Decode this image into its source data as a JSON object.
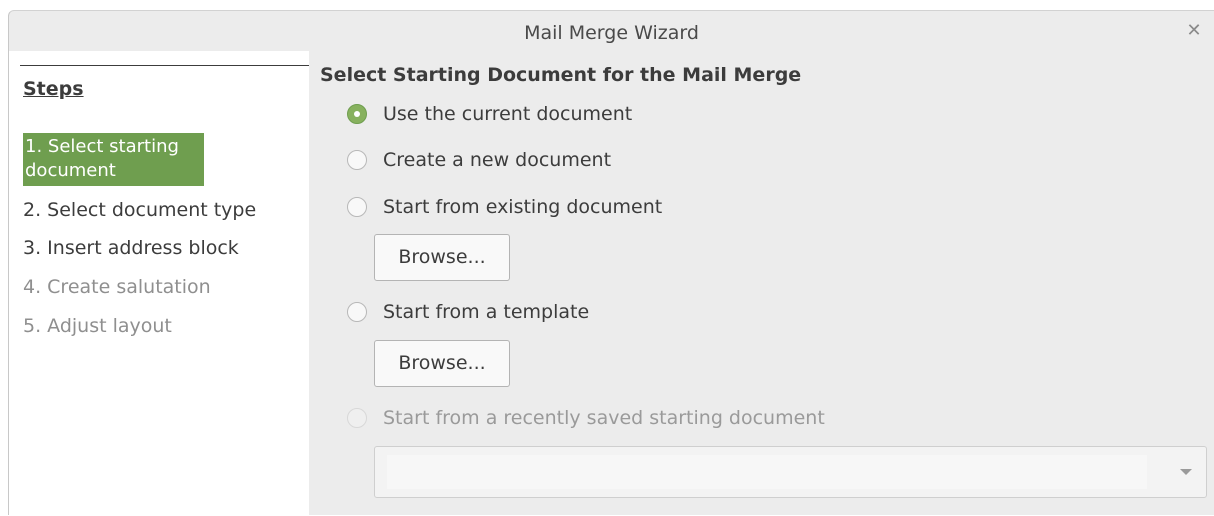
{
  "window": {
    "title": "Mail Merge Wizard"
  },
  "sidebar": {
    "heading": "Steps",
    "steps": [
      {
        "label": "1. Select starting document",
        "state": "active"
      },
      {
        "label": "2. Select document type",
        "state": "enabled"
      },
      {
        "label": "3. Insert address block",
        "state": "enabled"
      },
      {
        "label": "4. Create salutation",
        "state": "disabled"
      },
      {
        "label": "5. Adjust layout",
        "state": "disabled"
      }
    ]
  },
  "main": {
    "title": "Select Starting Document for the Mail Merge",
    "options": [
      {
        "label": "Use the current document",
        "checked": true,
        "enabled": true
      },
      {
        "label": "Create a new document",
        "checked": false,
        "enabled": true
      },
      {
        "label": "Start from existing document",
        "checked": false,
        "enabled": true
      },
      {
        "label": "Start from a template",
        "checked": false,
        "enabled": true
      },
      {
        "label": "Start from a recently saved starting document",
        "checked": false,
        "enabled": false
      }
    ],
    "browse_existing_label": "Browse...",
    "browse_template_label": "Browse...",
    "recent_select_value": ""
  },
  "colors": {
    "accent": "#6f9e4f",
    "radio_checked": "#87b15e"
  },
  "icons": {
    "close": "close-icon",
    "dropdown": "chevron-down-icon"
  }
}
